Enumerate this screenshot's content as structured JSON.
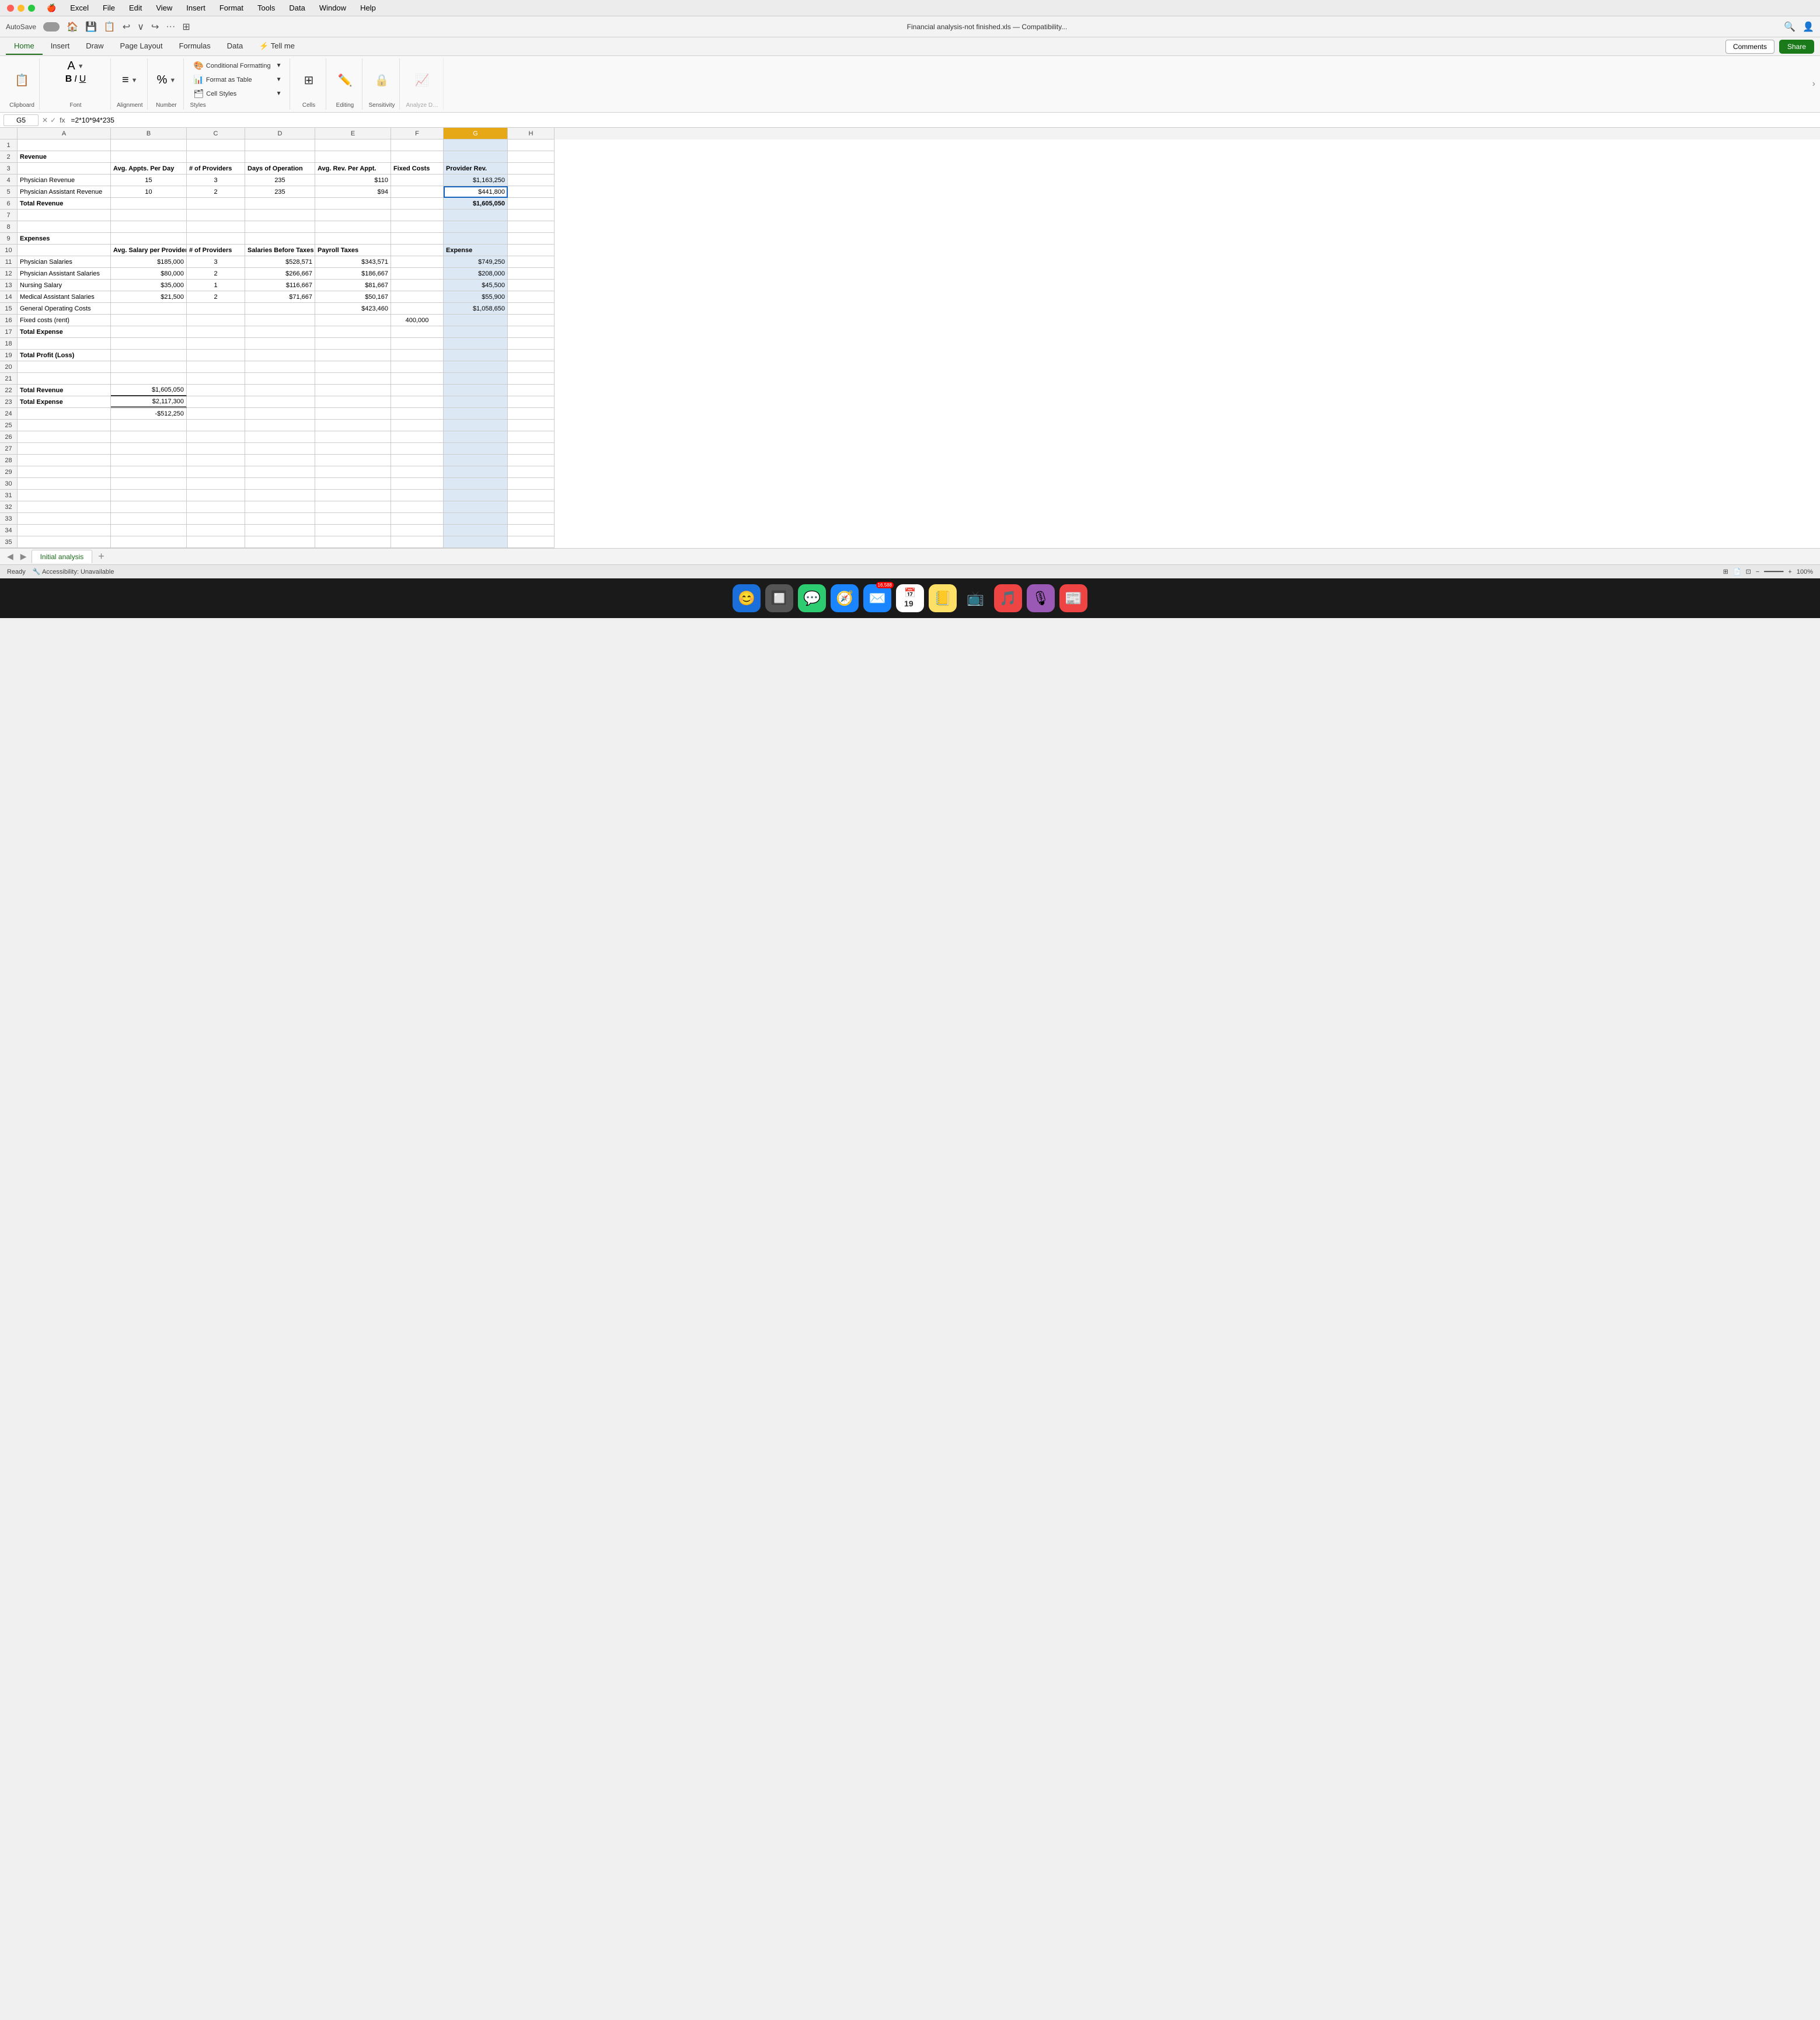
{
  "titleBar": {
    "menuItems": [
      "Apple",
      "Excel",
      "File",
      "Edit",
      "View",
      "Insert",
      "Format",
      "Tools",
      "Data",
      "Window",
      "Help"
    ]
  },
  "toolbar": {
    "autosaveLabel": "AutoSave",
    "windowTitle": "Financial analysis-not finished.xls — Compatibility...",
    "undoIcon": "↩",
    "redoIcon": "↪"
  },
  "ribbonTabs": {
    "tabs": [
      "Home",
      "Insert",
      "Draw",
      "Page Layout",
      "Formulas",
      "Data",
      "Tell me"
    ],
    "activeTab": "Home",
    "commentsLabel": "Comments",
    "shareLabel": "Share"
  },
  "ribbonGroups": {
    "clipboard": {
      "label": "Clipboard"
    },
    "font": {
      "label": "Font"
    },
    "alignment": {
      "label": "Alignment"
    },
    "number": {
      "label": "Number"
    },
    "styles": {
      "conditionalFormatting": "Conditional Formatting",
      "formatAsTable": "Format as Table",
      "cellStyles": "Cell Styles",
      "label": "Styles"
    },
    "cells": {
      "label": "Cells"
    },
    "editing": {
      "label": "Editing"
    },
    "sensitivity": {
      "label": "Sensitivity"
    }
  },
  "formulaBar": {
    "cellRef": "G5",
    "formula": "=2*10*94*235"
  },
  "columns": [
    "A",
    "B",
    "C",
    "D",
    "E",
    "F",
    "G",
    "H"
  ],
  "rows": [
    {
      "num": 1,
      "cells": [
        "",
        "",
        "",
        "",
        "",
        "",
        "",
        ""
      ]
    },
    {
      "num": 2,
      "cells": [
        "Revenue",
        "",
        "",
        "",
        "",
        "",
        "",
        ""
      ]
    },
    {
      "num": 3,
      "cells": [
        "",
        "Avg. Appts. Per Day",
        "# of Providers",
        "Days of Operation",
        "Avg. Rev. Per Appt.",
        "Fixed Costs",
        "Provider Rev.",
        ""
      ]
    },
    {
      "num": 4,
      "cells": [
        "Physician Revenue",
        "15",
        "3",
        "235",
        "$110",
        "",
        "$1,163,250",
        ""
      ]
    },
    {
      "num": 5,
      "cells": [
        "Physician Assistant Revenue",
        "10",
        "2",
        "235",
        "$94",
        "",
        "$441,800",
        ""
      ]
    },
    {
      "num": 6,
      "cells": [
        "Total Revenue",
        "",
        "",
        "",
        "",
        "",
        "$1,605,050",
        ""
      ]
    },
    {
      "num": 7,
      "cells": [
        "",
        "",
        "",
        "",
        "",
        "",
        "",
        ""
      ]
    },
    {
      "num": 8,
      "cells": [
        "",
        "",
        "",
        "",
        "",
        "",
        "",
        ""
      ]
    },
    {
      "num": 9,
      "cells": [
        "Expenses",
        "",
        "",
        "",
        "",
        "",
        "",
        ""
      ]
    },
    {
      "num": 10,
      "cells": [
        "",
        "Avg. Salary per Provider",
        "# of Providers",
        "Salaries Before Taxes",
        "Payroll Taxes",
        "",
        "Expense",
        ""
      ]
    },
    {
      "num": 11,
      "cells": [
        "Physician Salaries",
        "$185,000",
        "3",
        "$528,571",
        "$343,571",
        "",
        "$749,250",
        ""
      ]
    },
    {
      "num": 12,
      "cells": [
        "Physician Assistant Salaries",
        "$80,000",
        "2",
        "$266,667",
        "$186,667",
        "",
        "$208,000",
        ""
      ]
    },
    {
      "num": 13,
      "cells": [
        "Nursing Salary",
        "$35,000",
        "1",
        "$116,667",
        "$81,667",
        "",
        "$45,500",
        ""
      ]
    },
    {
      "num": 14,
      "cells": [
        "Medical Assistant Salaries",
        "$21,500",
        "2",
        "$71,667",
        "$50,167",
        "",
        "$55,900",
        ""
      ]
    },
    {
      "num": 15,
      "cells": [
        "General Operating Costs",
        "",
        "",
        "",
        "$423,460",
        "",
        "$1,058,650",
        ""
      ]
    },
    {
      "num": 16,
      "cells": [
        "Fixed costs (rent)",
        "",
        "",
        "",
        "",
        "400,000",
        "",
        ""
      ]
    },
    {
      "num": 17,
      "cells": [
        "Total Expense",
        "",
        "",
        "",
        "",
        "",
        "",
        ""
      ]
    },
    {
      "num": 18,
      "cells": [
        "",
        "",
        "",
        "",
        "",
        "",
        "",
        ""
      ]
    },
    {
      "num": 19,
      "cells": [
        "Total Profit (Loss)",
        "",
        "",
        "",
        "",
        "",
        "",
        ""
      ]
    },
    {
      "num": 20,
      "cells": [
        "",
        "",
        "",
        "",
        "",
        "",
        "",
        ""
      ]
    },
    {
      "num": 21,
      "cells": [
        "",
        "",
        "",
        "",
        "",
        "",
        "",
        ""
      ]
    },
    {
      "num": 22,
      "cells": [
        "Total Revenue",
        "$1,605,050",
        "",
        "",
        "",
        "",
        "",
        ""
      ]
    },
    {
      "num": 23,
      "cells": [
        "Total Expense",
        "$2,117,300",
        "",
        "",
        "",
        "",
        "",
        ""
      ]
    },
    {
      "num": 24,
      "cells": [
        "",
        "-$512,250",
        "",
        "",
        "",
        "",
        "",
        ""
      ]
    },
    {
      "num": 25,
      "cells": [
        "",
        "",
        "",
        "",
        "",
        "",
        "",
        ""
      ]
    },
    {
      "num": 26,
      "cells": [
        "",
        "",
        "",
        "",
        "",
        "",
        "",
        ""
      ]
    },
    {
      "num": 27,
      "cells": [
        "",
        "",
        "",
        "",
        "",
        "",
        "",
        ""
      ]
    },
    {
      "num": 28,
      "cells": [
        "",
        "",
        "",
        "",
        "",
        "",
        "",
        ""
      ]
    },
    {
      "num": 29,
      "cells": [
        "",
        "",
        "",
        "",
        "",
        "",
        "",
        ""
      ]
    },
    {
      "num": 30,
      "cells": [
        "",
        "",
        "",
        "",
        "",
        "",
        "",
        ""
      ]
    },
    {
      "num": 31,
      "cells": [
        "",
        "",
        "",
        "",
        "",
        "",
        "",
        ""
      ]
    },
    {
      "num": 32,
      "cells": [
        "",
        "",
        "",
        "",
        "",
        "",
        "",
        ""
      ]
    },
    {
      "num": 33,
      "cells": [
        "",
        "",
        "",
        "",
        "",
        "",
        "",
        ""
      ]
    },
    {
      "num": 34,
      "cells": [
        "",
        "",
        "",
        "",
        "",
        "",
        "",
        ""
      ]
    },
    {
      "num": 35,
      "cells": [
        "",
        "",
        "",
        "",
        "",
        "",
        "",
        ""
      ]
    }
  ],
  "sheetTabs": {
    "tabs": [
      "Initial analysis"
    ],
    "addLabel": "+"
  },
  "statusBar": {
    "ready": "Ready",
    "accessibility": "Accessibility: Unavailable",
    "zoom": "100%"
  },
  "dock": {
    "icons": [
      "🍎",
      "😊",
      "📱",
      "🧭",
      "✉️",
      "📅",
      "📒",
      "🎵",
      "📺",
      "🎶",
      "📻",
      "📰"
    ],
    "emailBadge": "16,588",
    "dateBadge": "19"
  }
}
